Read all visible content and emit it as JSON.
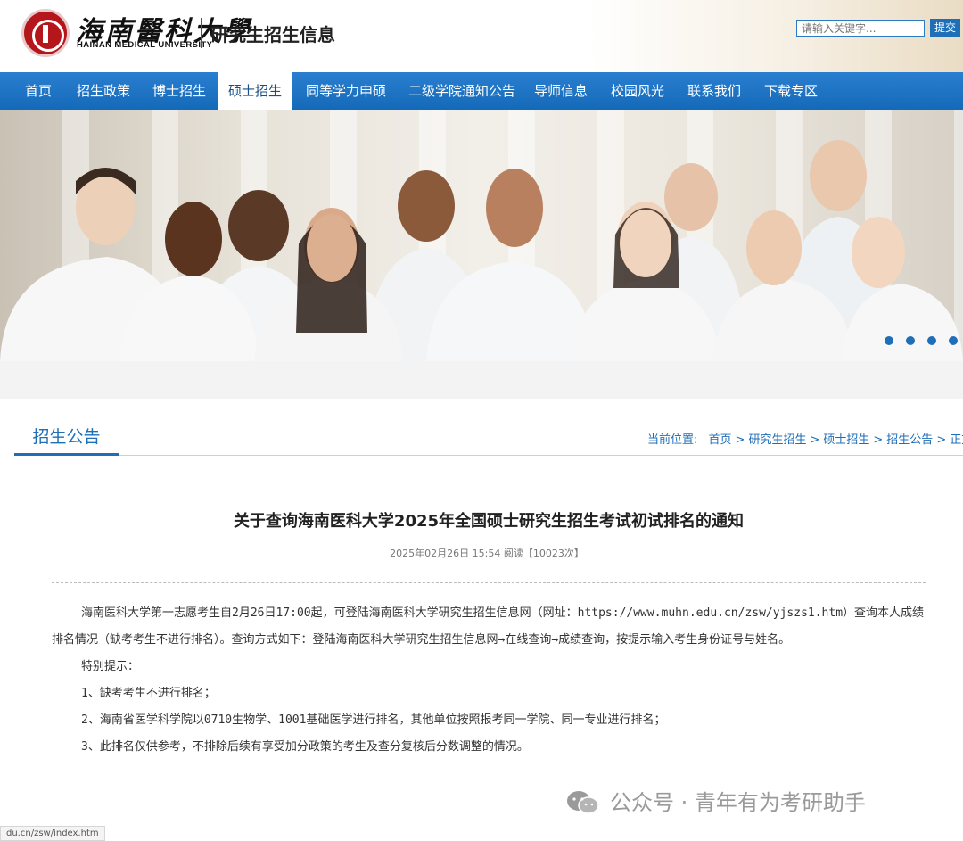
{
  "header": {
    "university_cn": "海南醫科大學",
    "university_en": "HAINAN MEDICAL UNIVERSITY",
    "site_title": "研究生招生信息",
    "search_placeholder": "请输入关键字...",
    "search_button": "提交"
  },
  "nav": {
    "items": [
      "首页",
      "招生政策",
      "博士招生",
      "硕士招生",
      "同等学力申硕",
      "二级学院通知公告",
      "导师信息",
      "校园风光",
      "联系我们",
      "下载专区"
    ],
    "active": "硕士招生"
  },
  "banner": {
    "slides": 4,
    "active_slide": 1
  },
  "section": {
    "title": "招生公告",
    "breadcrumb_label": "当前位置:",
    "breadcrumb": [
      "首页",
      "研究生招生",
      "硕士招生",
      "招生公告",
      "正文"
    ]
  },
  "article": {
    "title": "关于查询海南医科大学2025年全国硕士研究生招生考试初试排名的通知",
    "meta": "2025年02月26日 15:54 阅读【10023次】",
    "paragraphs": [
      "海南医科大学第一志愿考生自2月26日17:00起，可登陆海南医科大学研究生招生信息网（网址：https://www.muhn.edu.cn/zsw/yjszs1.htm）查询本人成绩排名情况（缺考考生不进行排名）。查询方式如下：登陆海南医科大学研究生招生信息网→在线查询→成绩查询，按提示输入考生身份证号与姓名。",
      "特别提示：",
      "1、缺考考生不进行排名；",
      "2、海南省医学科学院以0710生物学、1001基础医学进行排名，其他单位按照报考同一学院、同一专业进行排名；",
      "3、此排名仅供参考，不排除后续有享受加分政策的考生及查分复核后分数调整的情况。"
    ]
  },
  "watermark": "公众号 · 青年有为考研助手",
  "status_url": "du.cn/zsw/index.htm",
  "colors": {
    "primary": "#1f6fb8",
    "logo_red": "#b5161c"
  }
}
